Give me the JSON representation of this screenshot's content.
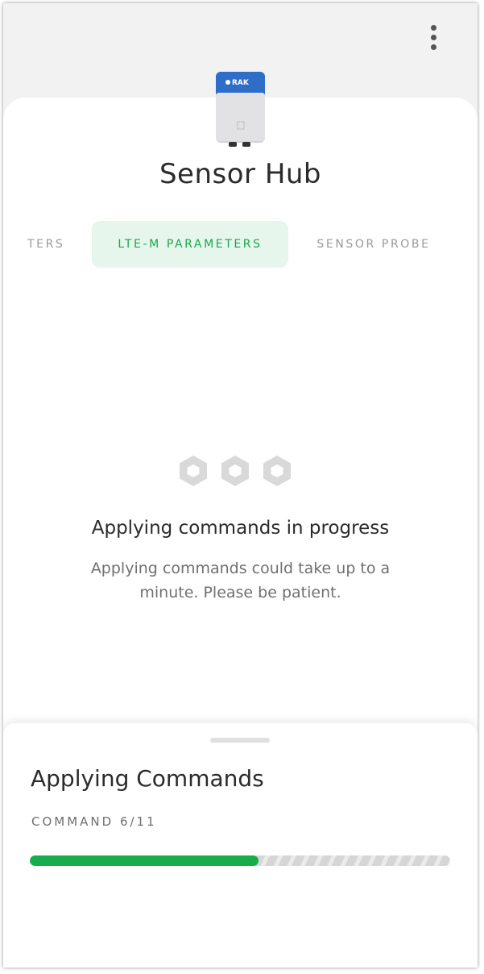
{
  "device": {
    "title": "Sensor Hub",
    "brand": "RAK"
  },
  "tabs": [
    {
      "label": "TERS",
      "active": false
    },
    {
      "label": "LTE-M PARAMETERS",
      "active": true
    },
    {
      "label": "SENSOR PROBE",
      "active": false
    }
  ],
  "progress": {
    "title": "Applying commands in progress",
    "body": "Applying commands could take up to a minute. Please be patient."
  },
  "sheet": {
    "title": "Applying Commands",
    "subtitle": "COMMAND 6/11",
    "current": 6,
    "total": 11
  },
  "colors": {
    "accent": "#17ad4d",
    "tab_active_bg": "#e7f6ec",
    "device_blue": "#2f6ec8"
  },
  "icons": {
    "menu": "more-vert-icon",
    "loader": "hexagon-loader-icon"
  }
}
